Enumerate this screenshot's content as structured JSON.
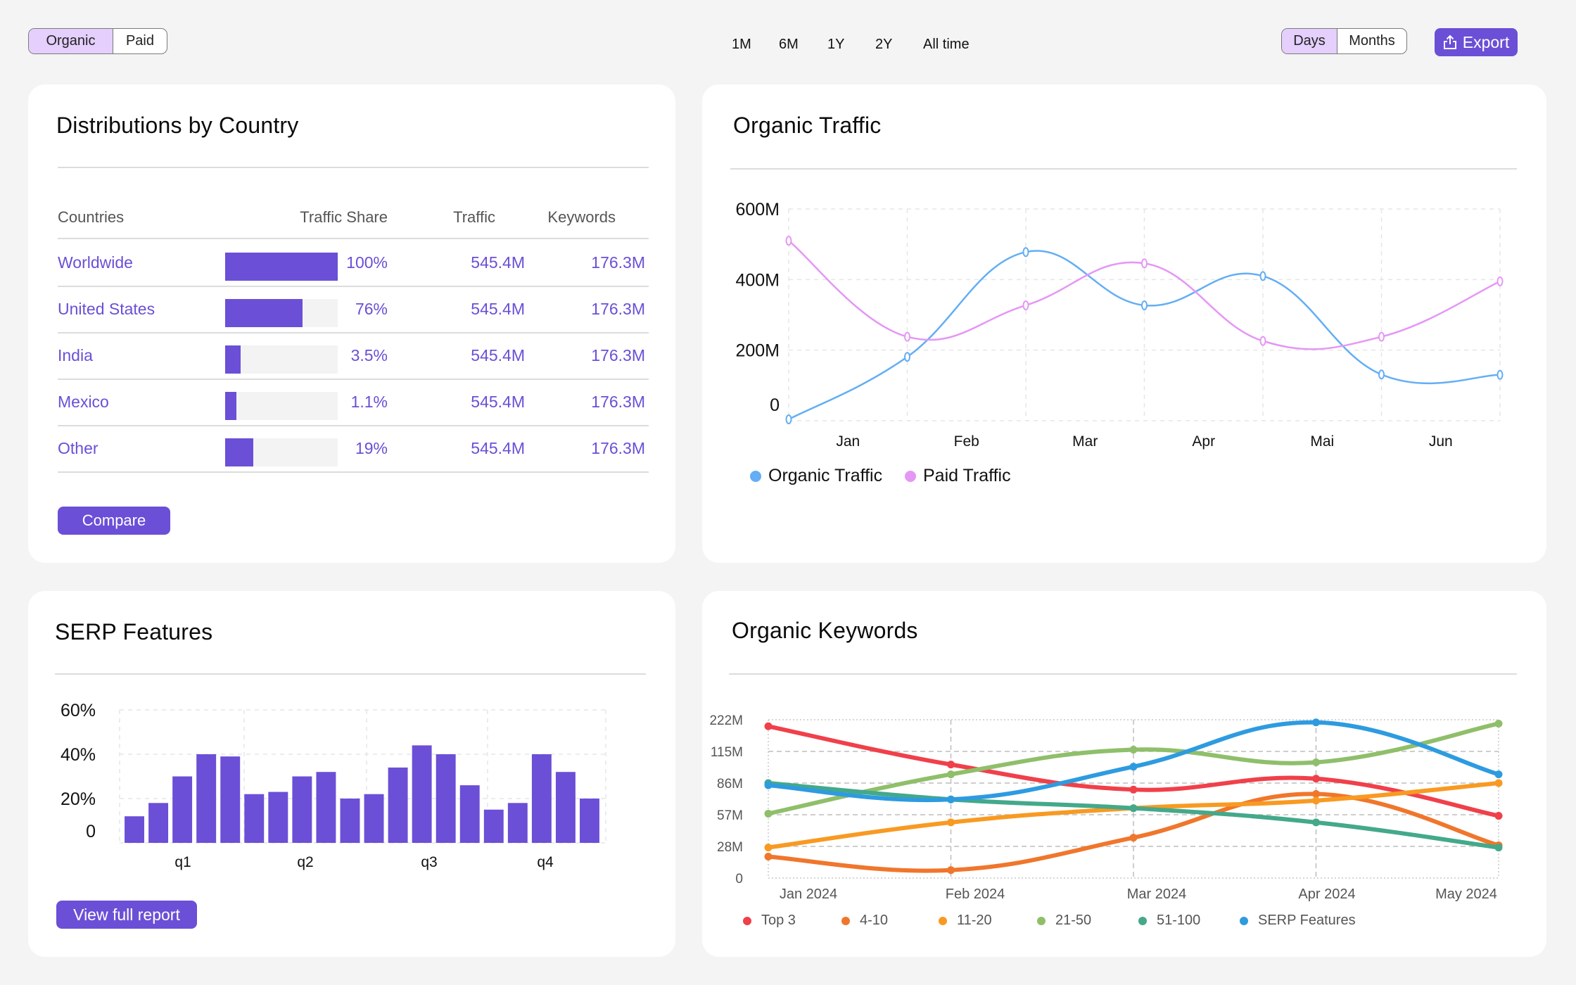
{
  "toolbar": {
    "source_toggle": [
      {
        "label": "Organic",
        "active": true
      },
      {
        "label": "Paid",
        "active": false
      }
    ],
    "ranges": [
      "1M",
      "6M",
      "1Y",
      "2Y",
      "All time"
    ],
    "granularity_toggle": [
      {
        "label": "Days",
        "active": true
      },
      {
        "label": "Months",
        "active": false
      }
    ],
    "export_label": "Export",
    "export_icon": "share-upload-icon"
  },
  "colors": {
    "accent": "#6b4fd6",
    "toggle_active": "#e4cffd",
    "organic": "#63aef5",
    "paid": "#e597f5"
  },
  "countries": {
    "title": "Distributions by Country",
    "headers": [
      "Countries",
      "Traffic Share",
      "Traffic",
      "Keywords"
    ],
    "rows": [
      {
        "name": "Worldwide",
        "share": "100%",
        "share_value": 100,
        "traffic": "545.4M",
        "keywords": "176.3M"
      },
      {
        "name": "United States",
        "share": "76%",
        "share_value": 69,
        "traffic": "545.4M",
        "keywords": "176.3M"
      },
      {
        "name": "India",
        "share": "3.5%",
        "share_value": 14,
        "traffic": "545.4M",
        "keywords": "176.3M"
      },
      {
        "name": "Mexico",
        "share": "1.1%",
        "share_value": 10,
        "traffic": "545.4M",
        "keywords": "176.3M"
      },
      {
        "name": "Other",
        "share": "19%",
        "share_value": 25,
        "traffic": "545.4M",
        "keywords": "176.3M"
      }
    ],
    "compare_label": "Compare"
  },
  "organic_traffic": {
    "title": "Organic Traffic"
  },
  "serp": {
    "title": "SERP Features",
    "button_label": "View full report"
  },
  "keywords": {
    "title": "Organic Keywords"
  },
  "chart_data": [
    {
      "id": "organic_traffic",
      "type": "line",
      "title": "Organic Traffic",
      "x_labels": [
        "Jan",
        "Feb",
        "Mar",
        "Apr",
        "Mai",
        "Jun"
      ],
      "points_per_series": 7,
      "yticks": [
        "0",
        "200M",
        "400M",
        "600M"
      ],
      "ylim": [
        0,
        600
      ],
      "yunit": "M",
      "grid": true,
      "legend": "bottom-left",
      "series": [
        {
          "name": "Organic Traffic",
          "color": "#63aef5",
          "values": [
            4,
            181,
            478,
            327,
            410,
            131,
            130
          ]
        },
        {
          "name": "Paid Traffic",
          "color": "#e597f5",
          "values": [
            510,
            238,
            327,
            446,
            226,
            238,
            395
          ]
        }
      ]
    },
    {
      "id": "serp_features",
      "type": "bar",
      "title": "SERP Features",
      "categories": [
        "q1",
        "q2",
        "q3",
        "q4"
      ],
      "bars_per_category": 5,
      "values": [
        12,
        18,
        30,
        40,
        39,
        22,
        23,
        30,
        32,
        20,
        22,
        34,
        44,
        40,
        26,
        15,
        18,
        40,
        32,
        20
      ],
      "yticks": [
        "0",
        "20%",
        "40%",
        "60%"
      ],
      "ylim": [
        0,
        60
      ],
      "yunit": "%",
      "color": "#6b4fd6",
      "grid": true
    },
    {
      "id": "organic_keywords",
      "type": "line",
      "title": "Organic Keywords",
      "x_labels": [
        "Jan 2024",
        "Feb 2024",
        "Mar 2024",
        "Apr 2024",
        "May 2024"
      ],
      "yticks": [
        "0",
        "28M",
        "57M",
        "86M",
        "115M",
        "222M"
      ],
      "ytick_values": [
        0,
        28,
        57,
        86,
        115,
        222
      ],
      "yunit": "M",
      "grid": true,
      "legend": "bottom",
      "series": [
        {
          "name": "Top 3",
          "color": "#f0404a",
          "values": [
            200,
            103,
            80,
            90,
            56
          ]
        },
        {
          "name": "4-10",
          "color": "#f0762c",
          "values": [
            19,
            7,
            36,
            76,
            29
          ]
        },
        {
          "name": "11-20",
          "color": "#f89a22",
          "values": [
            27,
            50,
            63,
            70,
            86
          ]
        },
        {
          "name": "21-50",
          "color": "#8fbf6a",
          "values": [
            58,
            94,
            121,
            105,
            209
          ]
        },
        {
          "name": "51-100",
          "color": "#43a98a",
          "values": [
            86,
            71,
            63,
            50,
            27
          ]
        },
        {
          "name": "SERP Features",
          "color": "#2e9be0",
          "values": [
            84,
            71,
            101,
            213,
            94
          ]
        }
      ]
    }
  ]
}
